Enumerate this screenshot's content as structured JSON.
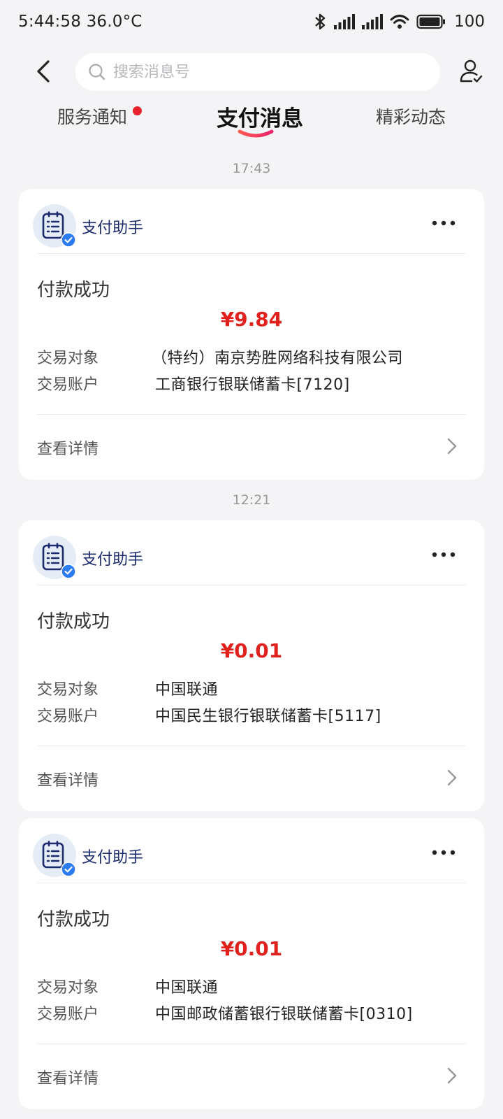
{
  "status_bar": {
    "time": "5:44:58",
    "temperature": "36.0°C",
    "battery": "100",
    "icons": [
      "bluetooth-icon",
      "signal-icon",
      "signal-icon",
      "wifi-icon",
      "battery-icon"
    ]
  },
  "header": {
    "search_placeholder": "搜索消息号",
    "icons": [
      "back-icon",
      "search-icon",
      "profile-icon"
    ]
  },
  "tabs": [
    {
      "label": "服务通知",
      "has_dot": true
    },
    {
      "label": "支付消息",
      "active": true
    },
    {
      "label": "精彩动态"
    }
  ],
  "accent_color": "#e0211e",
  "sender_color": "#1b2b6e",
  "messages": [
    {
      "time": "17:43",
      "sender": "支付助手",
      "title": "付款成功",
      "amount": "¥9.84",
      "merchant_label": "交易对象",
      "merchant": "（特约）南京势胜网络科技有限公司",
      "account_label": "交易账户",
      "account": "工商银行银联储蓄卡[7120]",
      "detail_label": "查看详情"
    },
    {
      "time": "12:21",
      "sender": "支付助手",
      "title": "付款成功",
      "amount": "¥0.01",
      "merchant_label": "交易对象",
      "merchant": "中国联通",
      "account_label": "交易账户",
      "account": "中国民生银行银联储蓄卡[5117]",
      "detail_label": "查看详情"
    },
    {
      "sender": "支付助手",
      "title": "付款成功",
      "amount": "¥0.01",
      "merchant_label": "交易对象",
      "merchant": "中国联通",
      "account_label": "交易账户",
      "account": "中国邮政储蓄银行银联储蓄卡[0310]",
      "detail_label": "查看详情"
    }
  ]
}
